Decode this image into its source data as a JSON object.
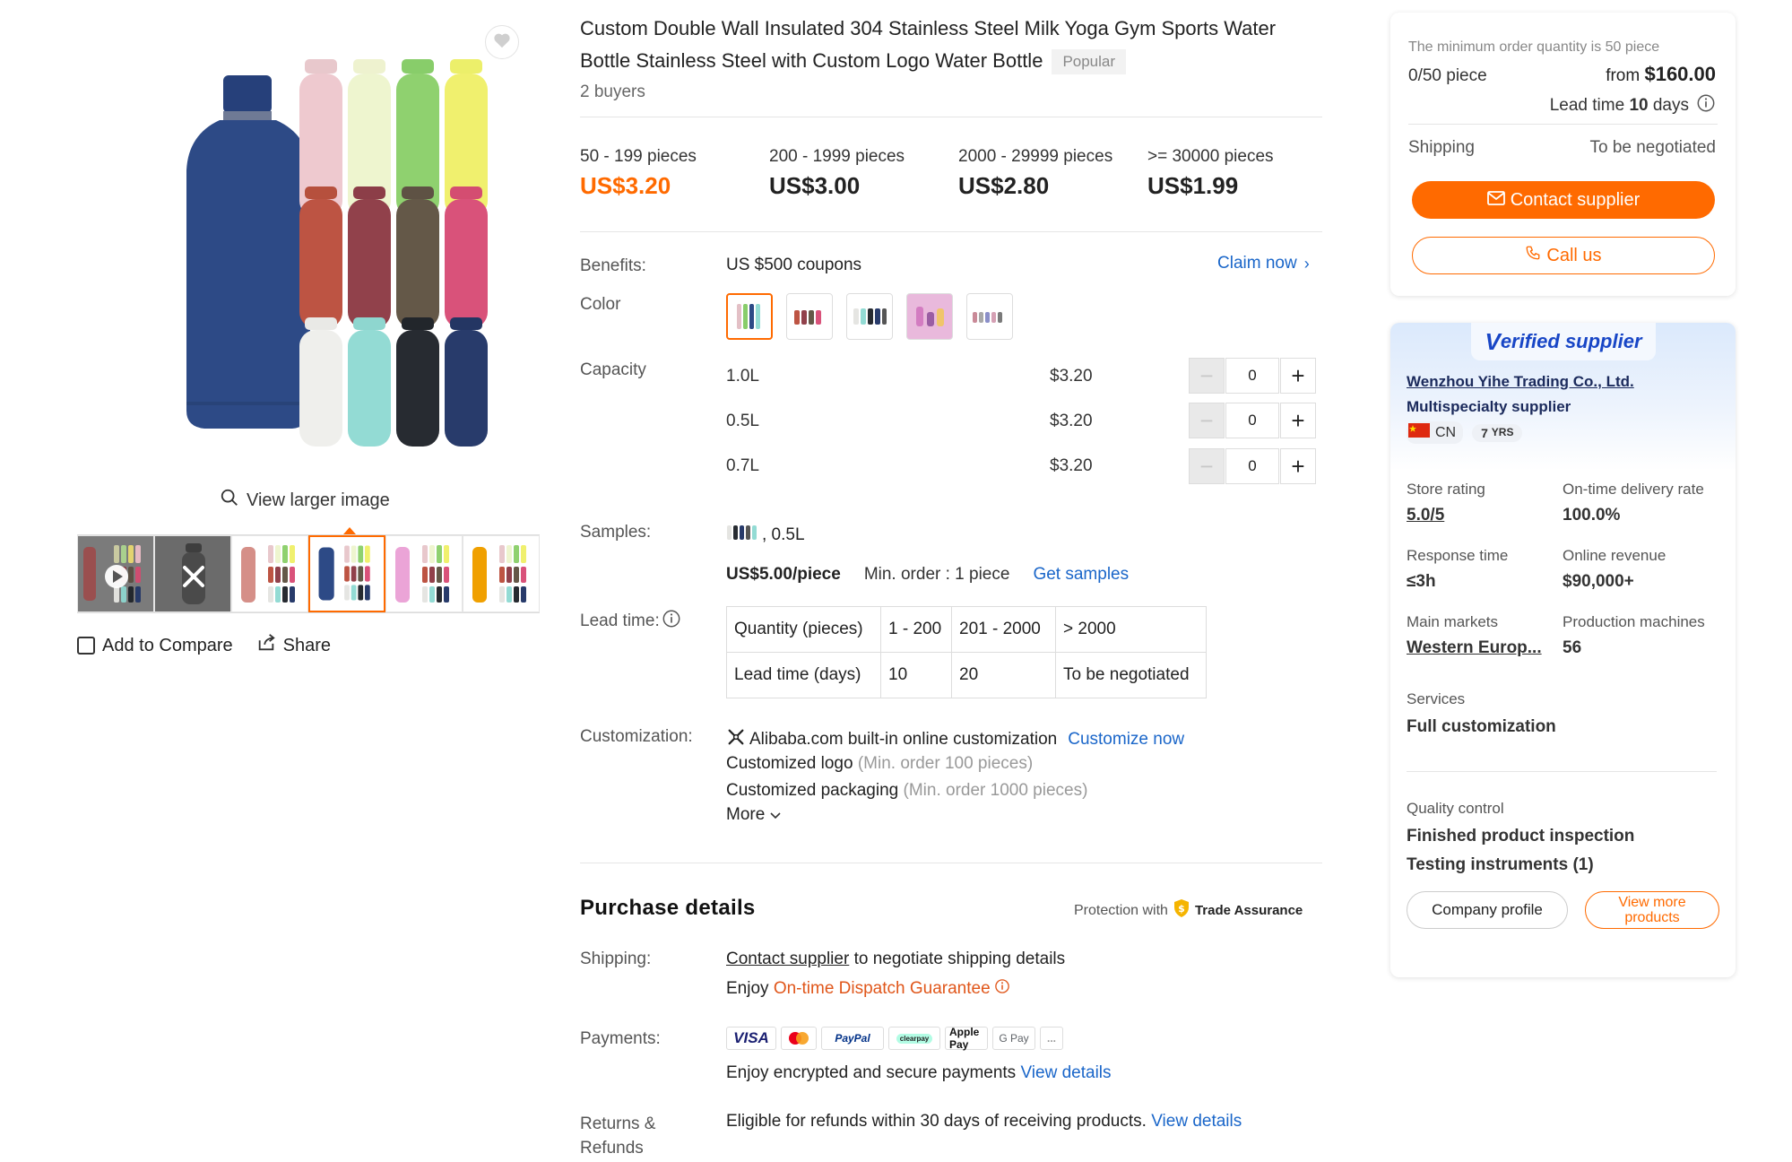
{
  "product": {
    "title": "Custom Double Wall Insulated 304 Stainless Steel Milk Yoga Gym Sports Water Bottle Stainless Steel with Custom Logo Water Bottle",
    "badge": "Popular",
    "buyers": "2 buyers"
  },
  "gallery": {
    "view_larger": "View larger image",
    "add_to_compare": "Add to Compare",
    "share": "Share"
  },
  "price_tiers": [
    {
      "range": "50 - 199 pieces",
      "price": "US$3.20"
    },
    {
      "range": "200 - 1999 pieces",
      "price": "US$3.00"
    },
    {
      "range": "2000 - 29999 pieces",
      "price": "US$2.80"
    },
    {
      "range": ">= 30000 pieces",
      "price": "US$1.99"
    }
  ],
  "benefits": {
    "label": "Benefits:",
    "value": "US $500 coupons",
    "link": "Claim now"
  },
  "color": {
    "label": "Color"
  },
  "capacity": {
    "label": "Capacity",
    "options": [
      {
        "size": "1.0L",
        "price": "$3.20",
        "qty": "0"
      },
      {
        "size": "0.5L",
        "price": "$3.20",
        "qty": "0"
      },
      {
        "size": "0.7L",
        "price": "$3.20",
        "qty": "0"
      }
    ]
  },
  "samples": {
    "label": "Samples:",
    "variant": ", 0.5L",
    "price": "US$5.00/piece",
    "min_order": "Min. order : 1 piece",
    "link": "Get samples"
  },
  "lead_time": {
    "label": "Lead time:",
    "row1": [
      "Quantity (pieces)",
      "1 - 200",
      "201 - 2000",
      "> 2000"
    ],
    "row2": [
      "Lead time (days)",
      "10",
      "20",
      "To be negotiated"
    ]
  },
  "customization": {
    "label": "Customization:",
    "builtin": "Alibaba.com built-in online customization",
    "link": "Customize now",
    "logo": "Customized logo",
    "logo_min": "(Min. order 100 pieces)",
    "packaging": "Customized packaging",
    "packaging_min": "(Min. order 1000 pieces)",
    "more": "More"
  },
  "purchase": {
    "title": "Purchase details",
    "protection": "Protection with",
    "trade_assurance": "Trade Assurance",
    "shipping_label": "Shipping:",
    "contact_link": "Contact supplier",
    "shipping_text": " to negotiate shipping details",
    "enjoy": "Enjoy ",
    "dispatch": "On-time Dispatch Guarantee",
    "payments_label": "Payments:",
    "payment_methods": [
      "VISA",
      "Mastercard",
      "PayPal",
      "clearpay",
      "Apple Pay",
      "G Pay",
      "..."
    ],
    "payments_text": "Enjoy encrypted and secure payments ",
    "view_details": "View details",
    "returns_label_1": "Returns &",
    "returns_label_2": "Refunds",
    "returns_text": "Eligible for refunds within 30 days of receiving products. "
  },
  "order_card": {
    "min_note": "The minimum order quantity is 50 piece",
    "count": "0/50 piece",
    "from": "from ",
    "price": "$160.00",
    "lead_prefix": "Lead time ",
    "lead_days": "10",
    "lead_suffix": " days",
    "shipping_label": "Shipping",
    "shipping_value": "To be negotiated",
    "contact_btn": "Contact supplier",
    "call_btn": "Call us"
  },
  "supplier": {
    "verified": "Verified supplier",
    "verified_v": "V",
    "verified_rest": "erified supplier",
    "name": "Wenzhou Yihe Trading Co., Ltd.",
    "type": "Multispecialty supplier",
    "country": "CN",
    "years": "7",
    "years_unit": "YRS",
    "stats": [
      {
        "label": "Store rating",
        "value": "5.0/5"
      },
      {
        "label": "On-time delivery rate",
        "value": "100.0%"
      },
      {
        "label": "Response time",
        "value": "≤3h"
      },
      {
        "label": "Online revenue",
        "value": "$90,000+"
      },
      {
        "label": "Main markets",
        "value": "Western Europ..."
      },
      {
        "label": "Production machines",
        "value": "56"
      }
    ],
    "services_label": "Services",
    "services_value": "Full customization",
    "qc_label": "Quality control",
    "qc_1": "Finished product inspection",
    "qc_2": "Testing instruments (1)",
    "company_profile": "Company profile",
    "view_more_1": "View more",
    "view_more_2": "products"
  },
  "colors": {
    "accent": "#ff6a00",
    "link": "#1a66c9",
    "verified_blue": "#1846c6"
  }
}
